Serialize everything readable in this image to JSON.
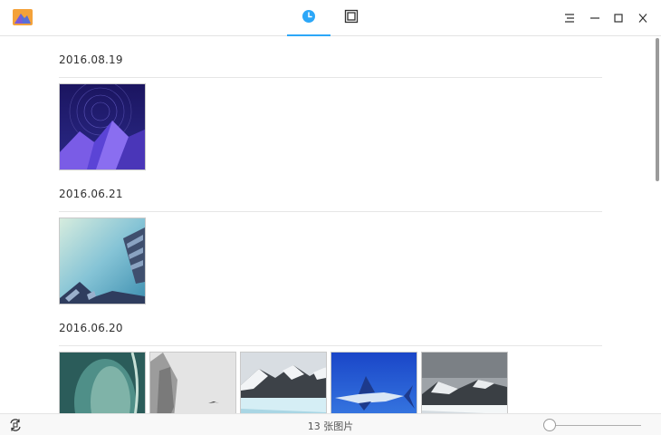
{
  "header": {
    "tabs": [
      {
        "icon": "clock-icon",
        "active": true
      },
      {
        "icon": "album-icon",
        "active": false
      }
    ],
    "window_buttons": [
      "menu-icon",
      "minimize-icon",
      "maximize-icon",
      "close-icon"
    ],
    "accent_color": "#2ca7f8"
  },
  "timeline": {
    "groups": [
      {
        "date": "2016.08.19",
        "photos": [
          "purple-mountain-stars"
        ]
      },
      {
        "date": "2016.06.21",
        "photos": [
          "building-sky"
        ]
      },
      {
        "date": "2016.06.20",
        "photos": [
          "teal-glass",
          "misty-cliff-bird",
          "glacier-mountain",
          "swordfish",
          "glacier-grey"
        ]
      }
    ]
  },
  "status": {
    "count": "13 张图片"
  },
  "zoom": {
    "level": 0
  }
}
